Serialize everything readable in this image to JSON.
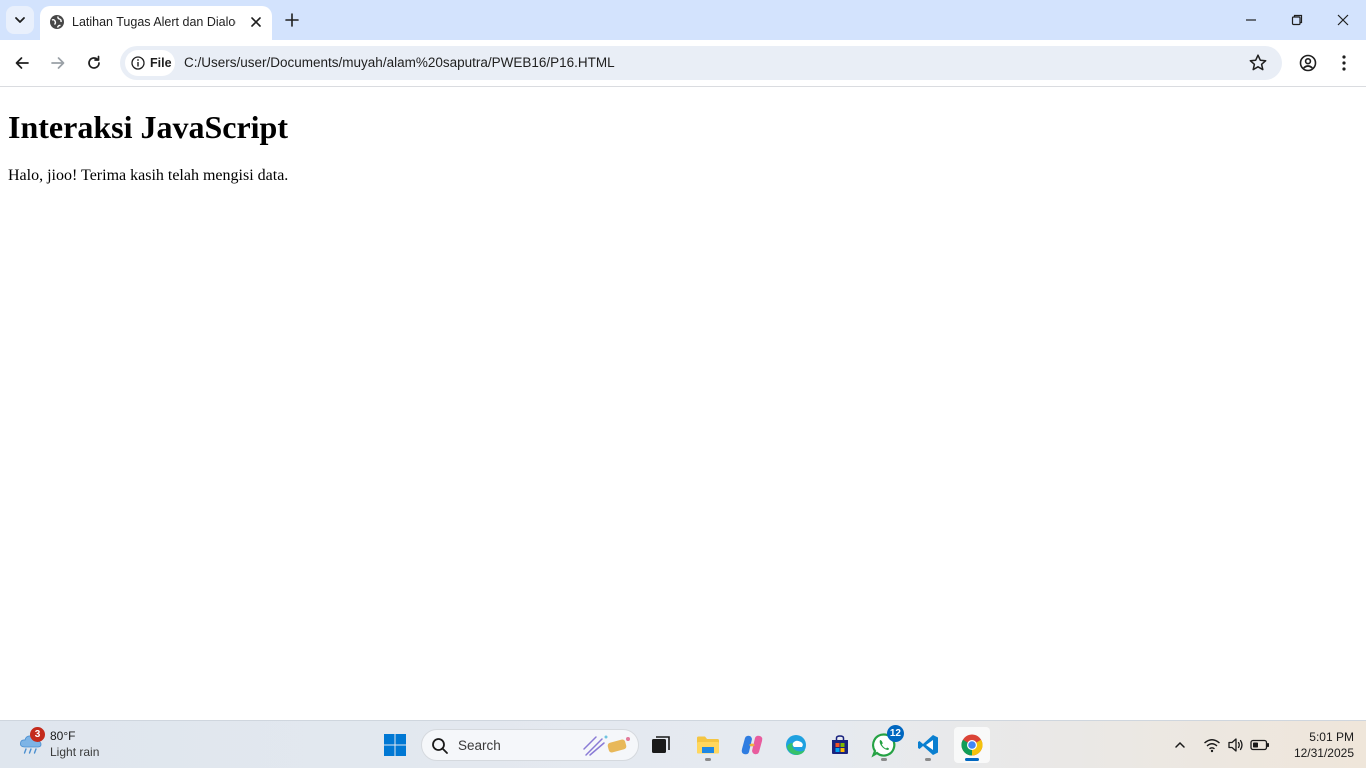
{
  "browser": {
    "tab_title": "Latihan Tugas Alert dan Dialog",
    "site_chip_label": "File",
    "url": "C:/Users/user/Documents/muyah/alam%20saputra/PWEB16/P16.HTML"
  },
  "page": {
    "heading": "Interaksi JavaScript",
    "message": "Halo, jioo! Terima kasih telah mengisi data."
  },
  "taskbar": {
    "weather_temp": "80°F",
    "weather_condition": "Light rain",
    "weather_badge": "3",
    "search_label": "Search",
    "whatsapp_badge": "12",
    "time": "5:01 PM",
    "date": "12/31/2025"
  },
  "colors": {
    "tabstrip": "#d3e3fd",
    "omnibox": "#e9eef6",
    "accent": "#0067c0"
  }
}
